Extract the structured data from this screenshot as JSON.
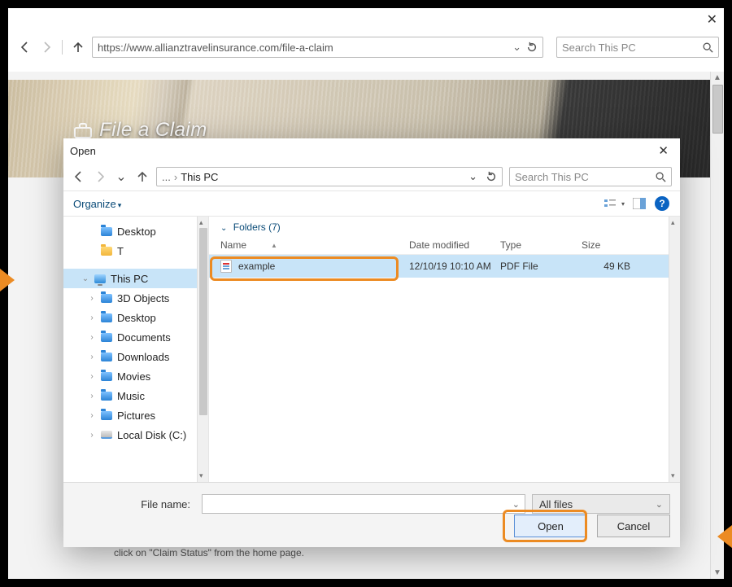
{
  "browser": {
    "url": "https://www.allianztravelinsurance.com/file-a-claim",
    "search_placeholder": "Search This PC"
  },
  "page": {
    "title": "File a Claim",
    "footer_hint": "click on \"Claim Status\" from the home page."
  },
  "dialog": {
    "title": "Open",
    "breadcrumb": {
      "dots": "...",
      "crumb": "This PC"
    },
    "search_placeholder": "Search This PC",
    "organize_label": "Organize",
    "group_header": "Folders (7)",
    "columns": {
      "name": "Name",
      "date": "Date modified",
      "type": "Type",
      "size": "Size"
    },
    "tree": [
      {
        "label": "Desktop",
        "icon": "folder-blue",
        "depth": 1,
        "exp": ""
      },
      {
        "label": "T",
        "icon": "folder",
        "depth": 1,
        "exp": ""
      },
      {
        "label": "",
        "spacer": true
      },
      {
        "label": "This PC",
        "icon": "pc",
        "depth": 0,
        "exp": "v",
        "selected": true
      },
      {
        "label": "3D Objects",
        "icon": "folder-blue",
        "depth": 1,
        "exp": ">"
      },
      {
        "label": "Desktop",
        "icon": "folder-blue",
        "depth": 1,
        "exp": ">"
      },
      {
        "label": "Documents",
        "icon": "folder-blue",
        "depth": 1,
        "exp": ">"
      },
      {
        "label": "Downloads",
        "icon": "folder-blue",
        "depth": 1,
        "exp": ">"
      },
      {
        "label": "Movies",
        "icon": "folder-blue",
        "depth": 1,
        "exp": ">"
      },
      {
        "label": "Music",
        "icon": "folder-blue",
        "depth": 1,
        "exp": ">"
      },
      {
        "label": "Pictures",
        "icon": "folder-blue",
        "depth": 1,
        "exp": ">"
      },
      {
        "label": "Local Disk (C:)",
        "icon": "disk",
        "depth": 1,
        "exp": ">"
      }
    ],
    "rows": [
      {
        "name": "example",
        "date": "12/10/19 10:10 AM",
        "type": "PDF File",
        "size": "49 KB",
        "selected": true
      }
    ],
    "file_name_label": "File name:",
    "file_name_value": "",
    "filter_label": "All files",
    "open_label": "Open",
    "cancel_label": "Cancel"
  }
}
